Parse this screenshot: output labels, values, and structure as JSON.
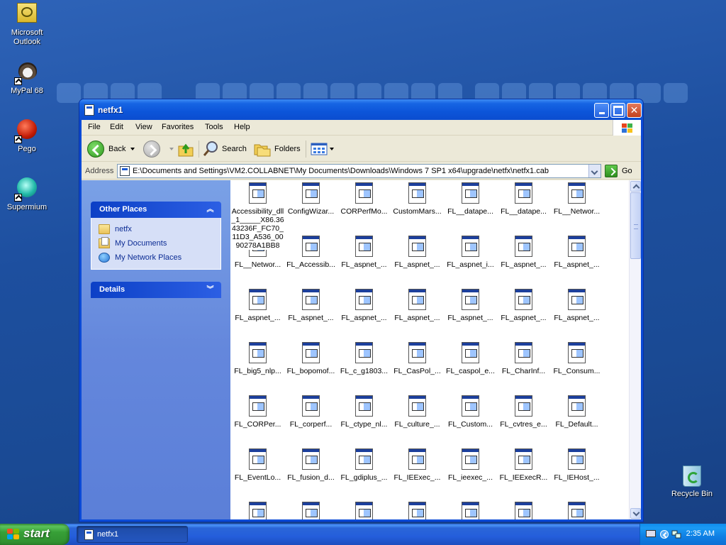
{
  "desktop": {
    "icons": [
      {
        "label": "Microsoft Outlook",
        "icon": "outlook-icon"
      },
      {
        "label": "MyPal 68",
        "icon": "mypal-icon"
      },
      {
        "label": "Pego",
        "icon": "pego-icon"
      },
      {
        "label": "Supermium",
        "icon": "supermium-icon"
      }
    ],
    "recycle_bin": "Recycle Bin"
  },
  "window": {
    "title": "netfx1",
    "menu": [
      "File",
      "Edit",
      "View",
      "Favorites",
      "Tools",
      "Help"
    ],
    "toolbar": {
      "back": "Back",
      "search": "Search",
      "folders": "Folders"
    },
    "address": {
      "label": "Address",
      "value": "E:\\Documents and Settings\\VM2.COLLABNET\\My Documents\\Downloads\\Windows 7 SP1 x64\\upgrade\\netfx\\netfx1.cab",
      "go": "Go"
    },
    "taskpane": {
      "other_places": {
        "title": "Other Places",
        "items": [
          "netfx",
          "My Documents",
          "My Network Places"
        ]
      },
      "details": {
        "title": "Details"
      }
    },
    "files": [
      [
        "Accessibility_dll_1_____X86.3643236F_FC70_11D3_A536_0090278A1BB8",
        "ConfigWizar...",
        "CORPerfMo...",
        "CustomMars...",
        "FL__datape...",
        "FL__datape...",
        "FL__Networ..."
      ],
      [
        "FL__Networ...",
        "FL_Accessib...",
        "FL_aspnet_...",
        "FL_aspnet_...",
        "FL_aspnet_i...",
        "FL_aspnet_...",
        "FL_aspnet_..."
      ],
      [
        "FL_aspnet_...",
        "FL_aspnet_...",
        "FL_aspnet_...",
        "FL_aspnet_...",
        "FL_aspnet_...",
        "FL_aspnet_...",
        "FL_aspnet_..."
      ],
      [
        "FL_big5_nlp...",
        "FL_bopomof...",
        "FL_c_g1803...",
        "FL_CasPol_...",
        "FL_caspol_e...",
        "FL_CharInf...",
        "FL_Consum..."
      ],
      [
        "FL_CORPer...",
        "FL_corperf...",
        "FL_ctype_nl...",
        "FL_culture_...",
        "FL_Custom...",
        "FL_cvtres_e...",
        "FL_Default..."
      ],
      [
        "FL_EventLo...",
        "FL_fusion_d...",
        "FL_gdiplus_...",
        "FL_IEExec_...",
        "FL_ieexec_...",
        "FL_IEExecR...",
        "FL_IEHost_..."
      ],
      [
        "",
        "",
        "",
        "",
        "",
        "",
        ""
      ]
    ]
  },
  "taskbar": {
    "start": "start",
    "task": "netfx1",
    "clock": "2:35 AM"
  }
}
